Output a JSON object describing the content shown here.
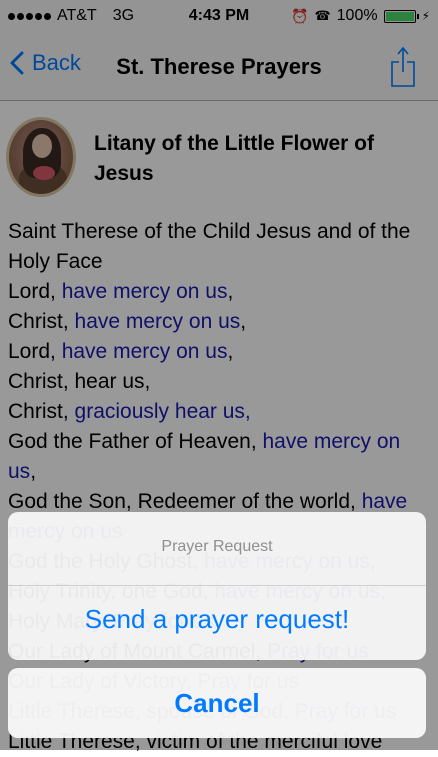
{
  "status_bar": {
    "carrier": "AT&T",
    "network": "3G",
    "time": "4:43 PM",
    "battery_percent": "100%",
    "signal_bars": 5,
    "battery_level": 1.0
  },
  "nav": {
    "back_label": "Back",
    "title": "St. Therese Prayers",
    "share_icon": "share-icon"
  },
  "prayer": {
    "title": "Litany of the Little Flower of Jesus",
    "lines": [
      {
        "text": "Saint Therese of the Child Jesus and of the Holy Face",
        "response": ""
      },
      {
        "text": "Lord, ",
        "response": "have mercy on us",
        "tail": ","
      },
      {
        "text": "Christ, ",
        "response": "have mercy on us",
        "tail": ","
      },
      {
        "text": "Lord, ",
        "response": "have mercy on us",
        "tail": ","
      },
      {
        "text": "Christ, hear us,",
        "response": ""
      },
      {
        "text": "Christ, ",
        "response": "graciously hear us,",
        "tail": ""
      },
      {
        "text": "God the Father of Heaven, ",
        "response": "have mercy on us",
        "tail": ","
      },
      {
        "text": "God the Son, Redeemer of the world, ",
        "response": "have mercy on us",
        "tail": ""
      },
      {
        "text": "God the Holy Ghost, ",
        "response": "have mercy on us,",
        "tail": ""
      },
      {
        "text": "Holy Trinity, one God, ",
        "response": "have mercy on us,",
        "tail": ""
      },
      {
        "text": "Holy Mary, ",
        "response": "Pray for us",
        "tail": ""
      },
      {
        "text": "Our Lady of Mount Carmel, ",
        "response": "Pray for us",
        "tail": ""
      },
      {
        "text": "Our Lady of Victory, ",
        "response": "Pray for us",
        "tail": ""
      },
      {
        "text": "Little Therese, spouse of God, ",
        "response": "Pray for us",
        "tail": ""
      },
      {
        "text": "Little Therese, victim of the merciful love",
        "response": "",
        "tail": ""
      }
    ]
  },
  "action_sheet": {
    "title": "Prayer Request",
    "action_label": "Send a prayer request!",
    "cancel_label": "Cancel"
  },
  "colors": {
    "accent": "#007aff",
    "response_text": "#1b1bb0",
    "battery": "#4cd964"
  }
}
